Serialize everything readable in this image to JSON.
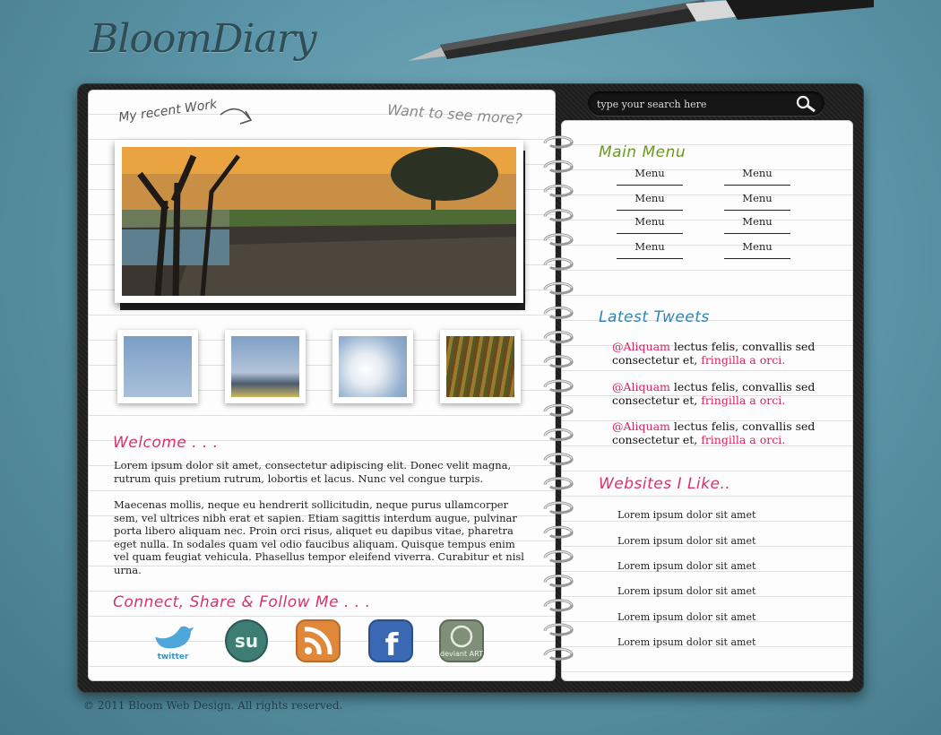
{
  "logo": "BloomDiary",
  "left_page": {
    "recent_work": "My recent Work",
    "want_more": "Want to see more?",
    "welcome_title": "Welcome . . .",
    "paragraphs": [
      "Lorem ipsum dolor sit amet, consectetur adipiscing elit. Donec velit magna, rutrum quis pretium rutrum, lobortis et lacus. Nunc vel congue turpis.",
      "Maecenas mollis, neque eu hendrerit sollicitudin, neque purus ullamcorper sem, vel ultrices nibh erat et sapien. Etiam sagittis interdum augue, pulvinar porta libero aliquam nec. Proin orci risus, aliquet eu dapibus vitae, pharetra eget nulla. In sodales quam vel odio faucibus aliquam. Quisque tempus enim vel quam feugiat vehicula. Phasellus tempor eleifend viverra. Curabitur et nisl urna."
    ],
    "connect_title": "Connect, Share & Follow Me . . .",
    "social": [
      "twitter",
      "stumbleupon-icon",
      "rss-icon",
      "facebook-icon",
      "deviantart-icon"
    ],
    "twitter_label": "twitter",
    "facebook_letter": "f",
    "deviant_label": "deviant ART"
  },
  "right_page": {
    "search_placeholder": "type your search here",
    "menu_title": "Main Menu",
    "menu_items": [
      "Menu",
      "Menu",
      "Menu",
      "Menu",
      "Menu",
      "Menu",
      "Menu",
      "Menu"
    ],
    "tweets_title": "Latest Tweets",
    "tweets": [
      {
        "handle": "@Aliquam",
        "text": " lectus felis, convallis sed consectetur et, ",
        "link": "fringilla a orci."
      },
      {
        "handle": "@Aliquam",
        "text": " lectus felis, convallis sed consectetur et, ",
        "link": "fringilla a orci."
      },
      {
        "handle": "@Aliquam",
        "text": " lectus felis, convallis sed consectetur et, ",
        "link": "fringilla a orci."
      }
    ],
    "sites_title": "Websites I Like..",
    "sites": [
      "Lorem ipsum dolor sit amet",
      "Lorem ipsum dolor sit amet",
      "Lorem ipsum dolor sit amet",
      "Lorem ipsum dolor sit amet",
      "Lorem ipsum dolor sit amet",
      "Lorem ipsum dolor sit amet"
    ]
  },
  "footer": "© 2011 Bloom Web Design. All rights reserved.",
  "colors": {
    "background": "#5d97a9",
    "accent_pink": "#d83366",
    "accent_green": "#6a9a1d",
    "accent_blue": "#2a86b8"
  }
}
